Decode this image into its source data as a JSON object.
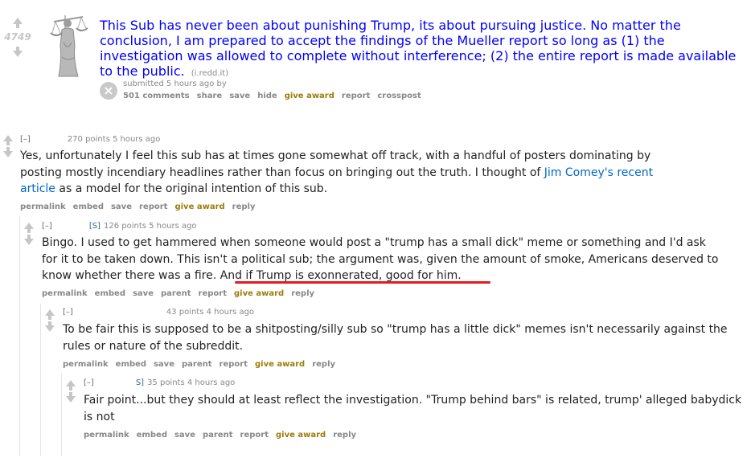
{
  "post": {
    "score": "4749",
    "title": "This Sub has never been about punishing Trump, its about pursuing justice. No matter the conclusion, I am prepared to accept the findings of the Mueller report so long as (1) the investigation was allowed to complete without interference; (2) the entire report is made available to the public.",
    "domain": "(i.redd.it)",
    "submitted": "submitted 5 hours ago by",
    "buttons": [
      "501 comments",
      "share",
      "save",
      "hide",
      "give award",
      "report",
      "crosspost"
    ]
  },
  "comments": [
    {
      "expand": "[–]",
      "submitter": "",
      "meta": "270 points 5 hours ago",
      "text_before": "Yes, unfortunately I feel this sub has at times gone somewhat off track, with a handful of posters dominating by posting mostly incendiary headlines rather than focus on bringing out the truth. I thought of ",
      "link": "Jim Comey's recent article",
      "text_after": " as a model for the original intention of this sub.",
      "buttons": [
        "permalink",
        "embed",
        "save",
        "report",
        "give award",
        "reply"
      ]
    },
    {
      "expand": "[–]",
      "submitter": "[S]",
      "meta": "126 points 5 hours ago",
      "text": "Bingo. I used to get hammered when someone would post a \"trump has a small dick\" meme or something and I'd ask for it to be taken down. This isn't a political sub; the argument was, given the amount of smoke, Americans deserved to know whether there was a fire. ",
      "highlight": "And if Trump is exonnerated, good for him.",
      "buttons": [
        "permalink",
        "embed",
        "save",
        "parent",
        "report",
        "give award",
        "reply"
      ]
    },
    {
      "expand": "[–]",
      "submitter": "",
      "meta": "43 points 4 hours ago",
      "text": "To be fair this is supposed to be a shitposting/silly sub so \"trump has a little dick\" memes isn't necessarily against the rules or nature of the subreddit.",
      "buttons": [
        "permalink",
        "embed",
        "save",
        "parent",
        "report",
        "give award",
        "reply"
      ]
    },
    {
      "expand": "[–]",
      "submitter": "S]",
      "meta": "35 points 4 hours ago",
      "text": "Fair point...but they should at least reflect the investigation. \"Trump behind bars\" is related, trump' alleged babydick is not",
      "buttons": [
        "permalink",
        "embed",
        "save",
        "parent",
        "report",
        "give award",
        "reply"
      ]
    }
  ],
  "colors": {
    "title": "#0000ff",
    "link": "#0066cc",
    "award": "#9a7d0a",
    "underline": "#e31b23"
  }
}
